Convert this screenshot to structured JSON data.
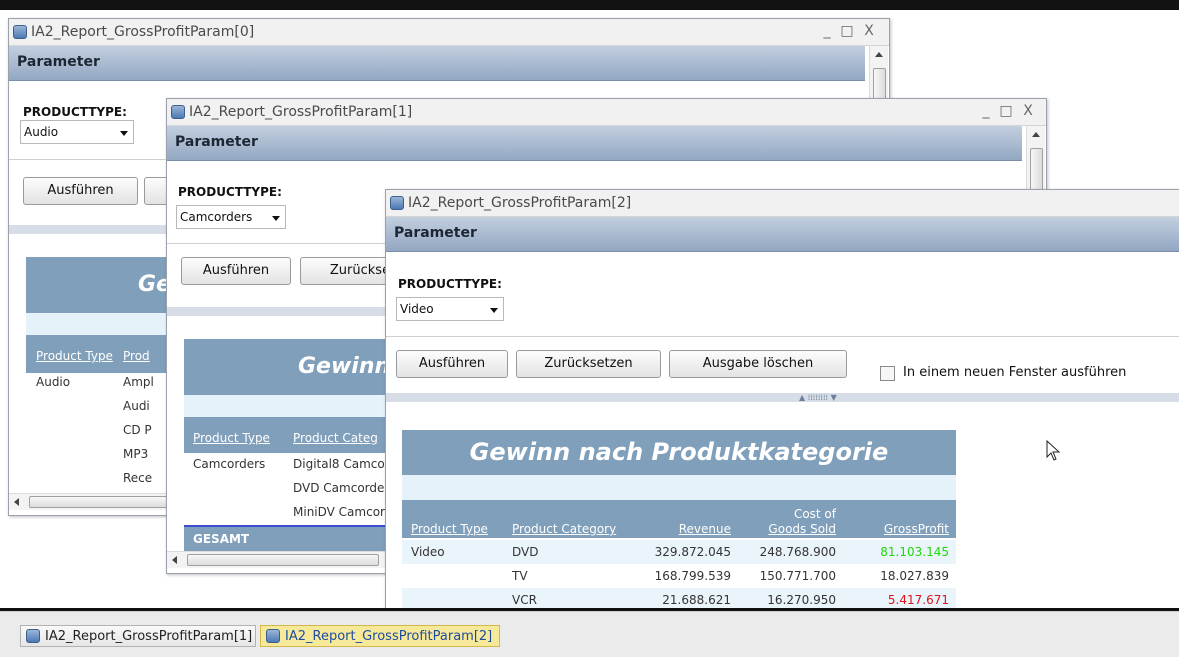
{
  "colors": {
    "report_header": "#7f9fbb",
    "param_bar": "#93a7c2",
    "positive_value": "#23d60b",
    "negative_value": "#e0141a"
  },
  "windows": [
    {
      "title": "IA2_Report_GrossProfitParam[0]",
      "param_header": "Parameter",
      "producttype_label": "PRODUCTTYPE:",
      "producttype_value": "Audio",
      "buttons": {
        "run": "Ausführen"
      },
      "report_title": "Ge",
      "columns": [
        "Product Type",
        "Prod"
      ],
      "rows": [
        {
          "type": "Audio",
          "category": "Ampl"
        },
        {
          "type": "",
          "category": "Audi"
        },
        {
          "type": "",
          "category": "CD P"
        },
        {
          "type": "",
          "category": "MP3"
        },
        {
          "type": "",
          "category": "Rece"
        }
      ]
    },
    {
      "title": "IA2_Report_GrossProfitParam[1]",
      "param_header": "Parameter",
      "producttype_label": "PRODUCTTYPE:",
      "producttype_value": "Camcorders",
      "buttons": {
        "run": "Ausführen",
        "reset": "Zurückse"
      },
      "report_title": "Gewinn n",
      "columns": [
        "Product Type",
        "Product Categ"
      ],
      "rows": [
        {
          "type": "Camcorders",
          "category": "Digital8 Camco"
        },
        {
          "type": "",
          "category": "DVD Camcorde"
        },
        {
          "type": "",
          "category": "MiniDV Camcor"
        }
      ],
      "total_label": "GESAMT"
    },
    {
      "title": "IA2_Report_GrossProfitParam[2]",
      "param_header": "Parameter",
      "producttype_label": "PRODUCTTYPE:",
      "producttype_value": "Video",
      "buttons": {
        "run": "Ausführen",
        "reset": "Zurücksetzen",
        "clear": "Ausgabe löschen"
      },
      "new_window_label": "In einem neuen Fenster ausführen",
      "splitter_label": "▲ ⁞⁞⁞⁞⁞⁞⁞⁞ ▼",
      "report_title": "Gewinn nach Produktkategorie",
      "columns": {
        "type": "Product Type",
        "category": "Product Category",
        "revenue": "Revenue",
        "cogs_line1": "Cost of",
        "cogs_line2": "Goods Sold",
        "gross": "GrossProfit"
      },
      "rows": [
        {
          "type": "Video",
          "category": "DVD",
          "revenue": "329.872.045",
          "cogs": "248.768.900",
          "gross": "81.103.145"
        },
        {
          "type": "",
          "category": "TV",
          "revenue": "168.799.539",
          "cogs": "150.771.700",
          "gross": "18.027.839"
        },
        {
          "type": "",
          "category": "VCR",
          "revenue": "21.688.621",
          "cogs": "16.270.950",
          "gross": "5.417.671"
        }
      ]
    }
  ],
  "taskbar": {
    "tabs": [
      {
        "label": "IA2_Report_GrossProfitParam[1]",
        "active": false
      },
      {
        "label": "IA2_Report_GrossProfitParam[2]",
        "active": true
      }
    ]
  },
  "window_controls": {
    "minimize": "_",
    "maximize": "□",
    "close": "X"
  }
}
